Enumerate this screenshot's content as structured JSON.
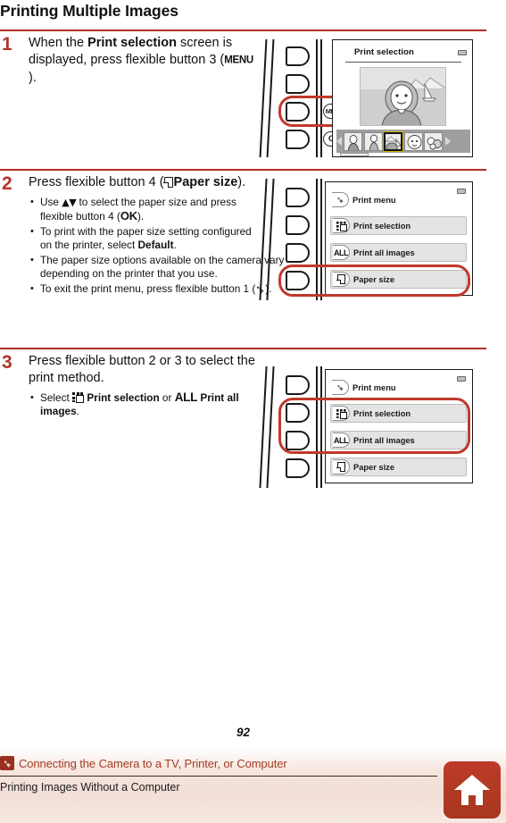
{
  "page": {
    "title": "Printing Multiple Images",
    "number": "92"
  },
  "steps": [
    {
      "number": "1",
      "heading_pre": "When the ",
      "heading_bold": "Print selection",
      "heading_post": " screen is displayed, press flexible button 3 (",
      "heading_glyph": "MENU",
      "heading_end": ").",
      "bullets": []
    },
    {
      "number": "2",
      "heading_pre": "Press flexible button 4 (",
      "heading_icon": "paper-size-icon",
      "heading_bold": "Paper size",
      "heading_end": ").",
      "bullets": [
        {
          "parts": [
            {
              "t": "Use "
            },
            {
              "t": "▲▼",
              "style": "arrows"
            },
            {
              "t": " to select the paper size and press flexible button 4 ("
            },
            {
              "t": "OK",
              "style": "ok"
            },
            {
              "t": ")."
            }
          ]
        },
        {
          "parts": [
            {
              "t": "To print with the paper size setting configured on the printer, select "
            },
            {
              "t": "Default",
              "style": "bold"
            },
            {
              "t": "."
            }
          ]
        },
        {
          "parts": [
            {
              "t": "The paper size options available on the camera vary depending on the printer that you use."
            }
          ]
        },
        {
          "parts": [
            {
              "t": "To exit the print menu, press flexible button 1 ("
            },
            {
              "t": "➦",
              "style": "back"
            },
            {
              "t": ")."
            }
          ]
        }
      ]
    },
    {
      "number": "3",
      "heading_pre": "Press flexible button 2 or 3 to select the print method.",
      "bullets": [
        {
          "parts": [
            {
              "t": "Select "
            },
            {
              "t": "",
              "style": "icon-sel"
            },
            {
              "t": "Print selection",
              "style": "bold"
            },
            {
              "t": " or "
            },
            {
              "t": "ALL",
              "style": "all"
            },
            {
              "t": " "
            },
            {
              "t": "Print all images",
              "style": "bold"
            },
            {
              "t": "."
            }
          ]
        }
      ]
    }
  ],
  "illustration_1": {
    "name": "camera-print-selection-screen",
    "screen_title": "Print selection",
    "button_menu_label": "MENU",
    "button_ok_label": "OK",
    "highlighted_button": "flexible button 3",
    "thumbnails": [
      {
        "selected": false
      },
      {
        "selected": false
      },
      {
        "selected": true
      },
      {
        "selected": false
      },
      {
        "selected": false
      }
    ]
  },
  "illustration_2": {
    "name": "camera-print-menu-paper-size",
    "items": [
      {
        "icon": "back-arrow-icon",
        "icon_text": "➦",
        "label": "Print menu",
        "header": true,
        "highlighted": false
      },
      {
        "icon": "print-selection-icon",
        "icon_text": "",
        "label": "Print selection",
        "header": false,
        "highlighted": false
      },
      {
        "icon": "all-icon",
        "icon_text": "ALL",
        "label": "Print all images",
        "header": false,
        "highlighted": false
      },
      {
        "icon": "paper-size-icon",
        "icon_text": "",
        "label": "Paper size",
        "header": false,
        "highlighted": true
      }
    ]
  },
  "illustration_3": {
    "name": "camera-print-menu-print-method",
    "items": [
      {
        "icon": "back-arrow-icon",
        "icon_text": "➦",
        "label": "Print menu",
        "header": true,
        "highlighted": false
      },
      {
        "icon": "print-selection-icon",
        "icon_text": "",
        "label": "Print selection",
        "header": false,
        "highlighted": true
      },
      {
        "icon": "all-icon",
        "icon_text": "ALL",
        "label": "Print all images",
        "header": false,
        "highlighted": true
      },
      {
        "icon": "paper-size-icon",
        "icon_text": "",
        "label": "Paper size",
        "header": false,
        "highlighted": false
      }
    ]
  },
  "footer": {
    "breadcrumb_icon": "back-arrow-icon",
    "breadcrumb": "Connecting the Camera to a TV, Printer, or Computer",
    "subtitle": "Printing Images Without a Computer",
    "home_button": "home-icon"
  },
  "colors": {
    "accent_red": "#b2352a",
    "rule_red": "#b03020",
    "highlight_ring": "#c0392b",
    "breadcrumb_text": "#a43c26",
    "home_button": "#b13a22"
  }
}
